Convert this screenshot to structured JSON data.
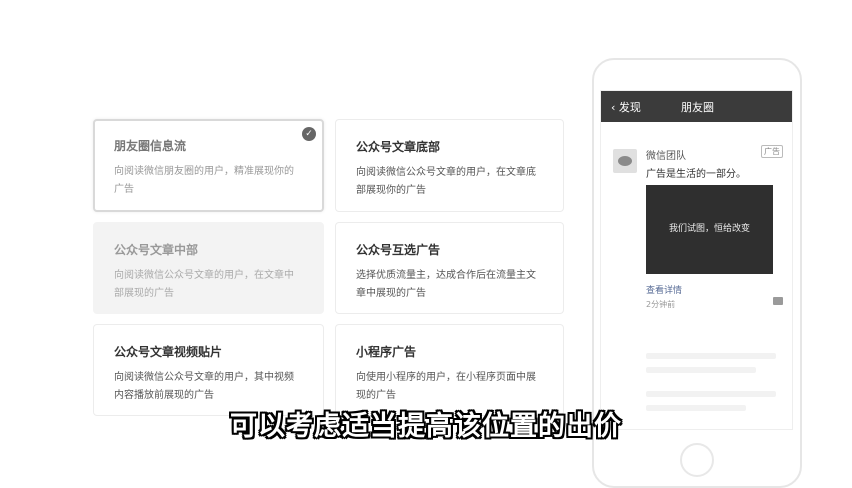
{
  "ad_positions": [
    {
      "title": "朋友圈信息流",
      "desc": "向阅读微信朋友圈的用户，精准展现你的广告"
    },
    {
      "title": "公众号文章底部",
      "desc": "向阅读微信公众号文章的用户，在文章底部展现你的广告"
    },
    {
      "title": "公众号文章中部",
      "desc": "向阅读微信公众号文章的用户，在文章中部展现的广告"
    },
    {
      "title": "公众号互选广告",
      "desc": "选择优质流量主，达成合作后在流量主文章中展现的广告"
    },
    {
      "title": "公众号文章视频贴片",
      "desc": "向阅读微信公众号文章的用户，其中视频内容播放前展现的广告"
    },
    {
      "title": "小程序广告",
      "desc": "向使用小程序的用户，在小程序页面中展现的广告"
    }
  ],
  "phone": {
    "back_label": "发现",
    "nav_title": "朋友圈",
    "account_name": "微信团队",
    "ad_tag": "广告",
    "ad_text": "广告是生活的一部分。",
    "ad_image_text": "我们试图，恒给改变",
    "detail_link": "查看详情",
    "time": "2分钟前"
  },
  "subtitle": "可以考虑适当提高该位置的出价"
}
